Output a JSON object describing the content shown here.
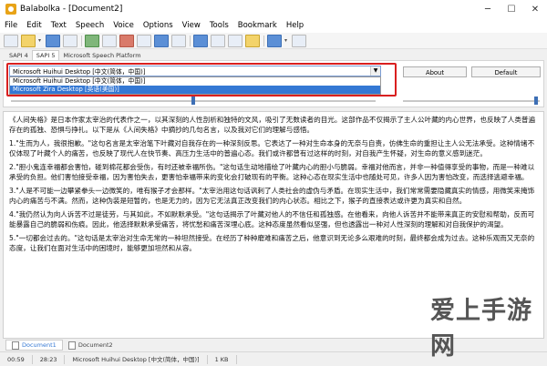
{
  "window": {
    "title": "Balabolka - [Document2]",
    "controls": {
      "minimize": "─",
      "maximize": "☐",
      "close": "✕"
    }
  },
  "menu": [
    "File",
    "Edit",
    "Text",
    "Speech",
    "Voice",
    "Options",
    "View",
    "Tools",
    "Bookmark",
    "Help"
  ],
  "voice_tabs": [
    "SAPI 4",
    "SAPI 5",
    "Microsoft Speech Platform"
  ],
  "voice_panel": {
    "selected_voice": "Microsoft Huihui Desktop [中文(简体，中国)]",
    "options": [
      "Microsoft Huihui Desktop [中文(简体，中国)]",
      "Microsoft Zira Desktop [英语(美国)]"
    ],
    "highlighted_option_index": 1,
    "about_label": "About",
    "default_label": "Default"
  },
  "document": {
    "paragraphs": [
      "《人间失格》是日本作家太宰治的代表作之一，以其深刻的人性剖析和独特的文风，吸引了无数读者的目光。这部作品不仅揭示了主人公叶藏的内心世界，也反映了人类普遍存在的孤独、恐惧与挣扎。以下是从《人间失格》中摘抄的几句名言，以及我对它们的理解与感悟。",
      "1.\"生而为人，我很抱歉。\"这句名言是太宰治笔下叶藏对自我存在的一种深刻反思。它表达了一种对生命本身的无奈与自责，仿佛生命的重担让主人公无法承受。这种情绪不仅体现了叶藏个人的痛苦，也反映了现代人在快节奏、高压力生活中的普遍心态。我们或许都曾有过这样的时刻，对自我产生怀疑，对生命的意义感到迷茫。",
      "2.\"胆小鬼连幸福都会害怕，碰到棉花都会受伤，有时还被幸福所伤。\"这句话生动地描绘了叶藏内心的胆小与脆弱。幸福对他而言，并非一种值得享受的事物，而是一种难以承受的负担。他们害怕接受幸福，因为害怕失去，更害怕幸福带来的变化会打破现有的平衡。这种心态在现实生活中也随处可见，许多人因为害怕改变，而选择逃避幸福。",
      "3.\"人是不可能一边攀紧拳头一边微笑的，唯有猴子才会那样。\"太宰治用这句话讽刺了人类社会的虚伪与矛盾。在现实生活中，我们常常需要隐藏真实的情感，用微笑来掩饰内心的痛苦与不满。然而，这种伪装是短暂的，也是无力的，因为它无法真正改变我们的内心状态。相比之下，猴子的直接表达或许更为真实和自然。",
      "4.\"我仍然认为向人诉苦不过是徒劳，与其如此，不如默默承受。\"这句话揭示了叶藏对他人的不信任和孤独感。在他看来，向他人诉苦并不能带来真正的安慰和帮助，反而可能暴露自己的脆弱和伤痕。因此，他选择默默承受痛苦，将忧愁和痛苦深埋心底。这种态度虽然看似坚强，但也透露出一种对人性深刻的理解和对自我保护的渴望。",
      "5.\"一切都会过去的。\"这句话是太宰治对生命无常的一种坦然接受。在经历了种种磨难和痛苦之后，他意识到无论多么艰难的时刻，最终都会成为过去。这种乐观而又无奈的态度，让我们在面对生活中的困境时，能够更加坦然和从容。"
    ]
  },
  "doc_tabs": [
    "Document1",
    "Document2"
  ],
  "status": [
    "00:59",
    "28:23",
    "Microsoft Huihui Desktop [中文(简体，中国)]",
    "1 KB"
  ],
  "watermark": "爱上手游网"
}
